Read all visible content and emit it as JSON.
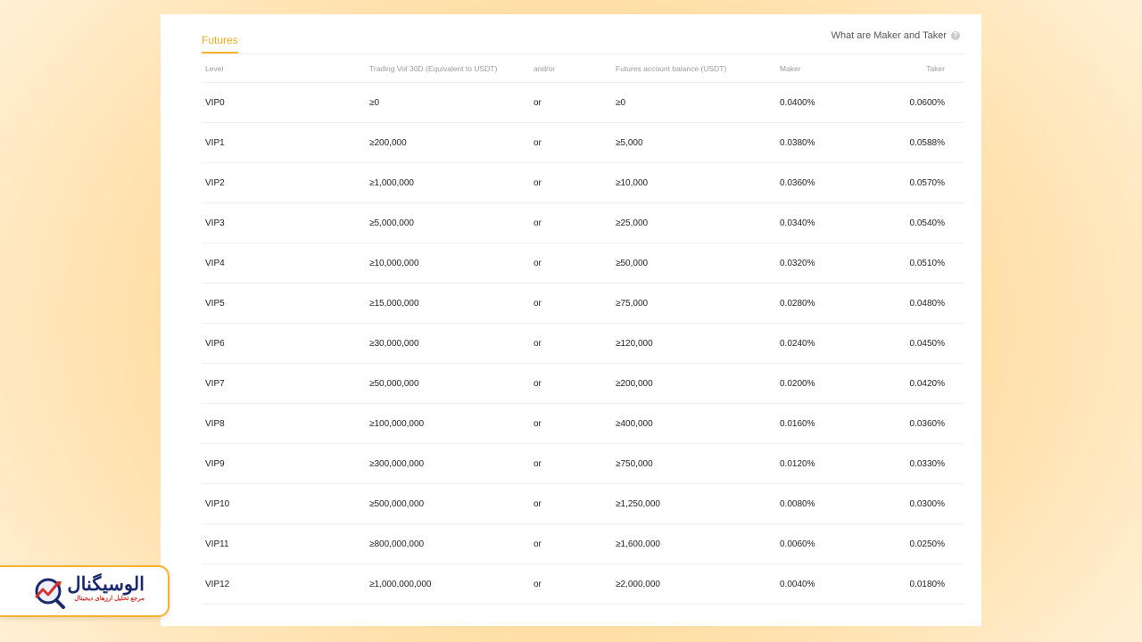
{
  "tab": {
    "label": "Futures"
  },
  "help": {
    "label": "What are Maker and Taker",
    "icon": "question-circle-icon"
  },
  "columns": {
    "level": "Level",
    "volume": "Trading Vol 30D (Equivalent to USDT)",
    "andor": "and/or",
    "balance": "Futures account balance (USDT)",
    "maker": "Maker",
    "taker": "Taker"
  },
  "rows": [
    {
      "level": "VIP0",
      "volume": "≥0",
      "andor": "or",
      "balance": "≥0",
      "maker": "0.0400%",
      "taker": "0.0600%"
    },
    {
      "level": "VIP1",
      "volume": "≥200,000",
      "andor": "or",
      "balance": "≥5,000",
      "maker": "0.0380%",
      "taker": "0.0588%"
    },
    {
      "level": "VIP2",
      "volume": "≥1,000,000",
      "andor": "or",
      "balance": "≥10,000",
      "maker": "0.0360%",
      "taker": "0.0570%"
    },
    {
      "level": "VIP3",
      "volume": "≥5,000,000",
      "andor": "or",
      "balance": "≥25,000",
      "maker": "0.0340%",
      "taker": "0.0540%"
    },
    {
      "level": "VIP4",
      "volume": "≥10,000,000",
      "andor": "or",
      "balance": "≥50,000",
      "maker": "0.0320%",
      "taker": "0.0510%"
    },
    {
      "level": "VIP5",
      "volume": "≥15,000,000",
      "andor": "or",
      "balance": "≥75,000",
      "maker": "0.0280%",
      "taker": "0.0480%"
    },
    {
      "level": "VIP6",
      "volume": "≥30,000,000",
      "andor": "or",
      "balance": "≥120,000",
      "maker": "0.0240%",
      "taker": "0.0450%"
    },
    {
      "level": "VIP7",
      "volume": "≥50,000,000",
      "andor": "or",
      "balance": "≥200,000",
      "maker": "0.0200%",
      "taker": "0.0420%"
    },
    {
      "level": "VIP8",
      "volume": "≥100,000,000",
      "andor": "or",
      "balance": "≥400,000",
      "maker": "0.0160%",
      "taker": "0.0360%"
    },
    {
      "level": "VIP9",
      "volume": "≥300,000,000",
      "andor": "or",
      "balance": "≥750,000",
      "maker": "0.0120%",
      "taker": "0.0330%"
    },
    {
      "level": "VIP10",
      "volume": "≥500,000,000",
      "andor": "or",
      "balance": "≥1,250,000",
      "maker": "0.0080%",
      "taker": "0.0300%"
    },
    {
      "level": "VIP11",
      "volume": "≥800,000,000",
      "andor": "or",
      "balance": "≥1,600,000",
      "maker": "0.0060%",
      "taker": "0.0250%"
    },
    {
      "level": "VIP12",
      "volume": "≥1,000,000,000",
      "andor": "or",
      "balance": "≥2,000,000",
      "maker": "0.0040%",
      "taker": "0.0180%"
    }
  ],
  "watermark": {
    "name": "الوسیگنال",
    "tagline": "مرجع تحلیل ارزهای دیجیتال",
    "icon": "magnifier-chart-icon"
  },
  "colors": {
    "accent": "#f5b22a",
    "brand_navy": "#1a2a6c",
    "brand_red": "#d2342a"
  }
}
